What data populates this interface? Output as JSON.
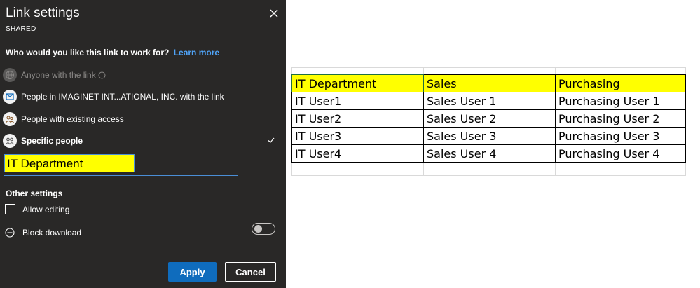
{
  "panel": {
    "title": "Link settings",
    "subtitle": "SHARED",
    "question": "Who would you like this link to work for?",
    "learn_more": "Learn more",
    "options": [
      {
        "label": "Anyone with the link",
        "icon": "globe-icon",
        "state": "disabled"
      },
      {
        "label": "People in IMAGINET INT...ATIONAL, INC. with the link",
        "icon": "building-icon",
        "state": "normal"
      },
      {
        "label": "People with existing access",
        "icon": "people-icon",
        "state": "normal"
      },
      {
        "label": "Specific people",
        "icon": "people-group-icon",
        "state": "selected"
      }
    ],
    "recipient_tag": "IT Department",
    "other_settings": "Other settings",
    "allow_editing": "Allow editing",
    "block_download": "Block download",
    "apply": "Apply",
    "cancel": "Cancel"
  },
  "spreadsheet": {
    "headers": [
      "IT Department",
      "Sales",
      "Purchasing"
    ],
    "rows": [
      [
        "IT User1",
        "Sales User 1",
        "Purchasing User 1"
      ],
      [
        "IT User2",
        "Sales User 2",
        "Purchasing User 2"
      ],
      [
        "IT User3",
        "Sales User 3",
        "Purchasing User 3"
      ],
      [
        "IT User4",
        "Sales User 4",
        "Purchasing User 4"
      ]
    ],
    "header_color": "#ffff00"
  },
  "colors": {
    "panel_bg": "#292827",
    "accent": "#0f6cbd",
    "link": "#4fa3f7"
  }
}
